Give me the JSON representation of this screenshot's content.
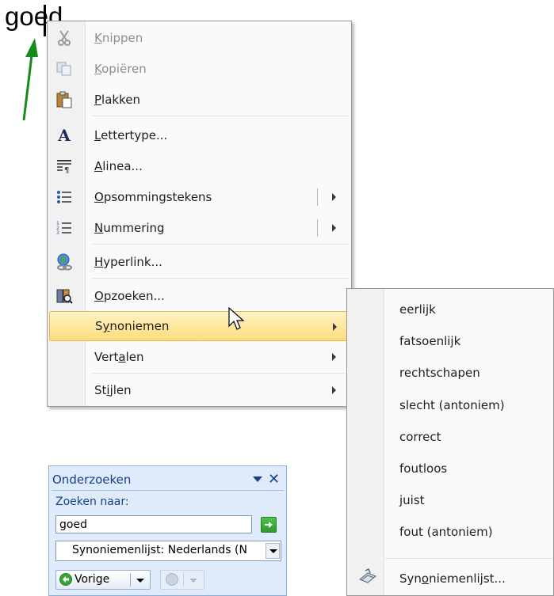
{
  "document": {
    "text": "goed"
  },
  "context_menu": {
    "items": [
      {
        "label": "Knippen",
        "underline": "K",
        "rest": "nippen",
        "icon": "scissors-icon",
        "disabled": true
      },
      {
        "label": "Kopiëren",
        "underline": "K",
        "rest": "opiëren",
        "icon": "copy-icon",
        "disabled": true
      },
      {
        "label": "Plakken",
        "underline": "P",
        "rest": "lakken",
        "icon": "paste-icon",
        "disabled": false
      },
      {
        "label": "Lettertype...",
        "underline": "L",
        "rest": "ettertype...",
        "icon": "font-icon"
      },
      {
        "label": "Alinea...",
        "underline": "A",
        "rest": "linea...",
        "icon": "paragraph-icon"
      },
      {
        "label": "Opsommingstekens",
        "underline": "O",
        "rest": "psommingstekens",
        "icon": "bullets-icon",
        "submenu": true
      },
      {
        "label": "Nummering",
        "underline": "N",
        "rest": "ummering",
        "icon": "numbering-icon",
        "submenu": true
      },
      {
        "label": "Hyperlink...",
        "underline": "H",
        "rest": "yperlink...",
        "icon": "hyperlink-icon"
      },
      {
        "label": "Opzoeken...",
        "underline": "O",
        "rest": "pzoeken...",
        "icon": "research-icon"
      },
      {
        "label": "Synoniemen",
        "pre": "S",
        "underline": "y",
        "rest": "noniemen",
        "submenu": true,
        "highlighted": true
      },
      {
        "label": "Vertalen",
        "pre": "Vert",
        "underline": "a",
        "rest": "len",
        "submenu": true
      },
      {
        "label": "Stijlen",
        "pre": "St",
        "underline": "i",
        "rest": "jlen",
        "submenu": true
      }
    ]
  },
  "synonyms_menu": {
    "items": [
      "eerlijk",
      "fatsoenlijk",
      "rechtschapen",
      "slecht (antoniem)",
      "correct",
      "foutloos",
      "juist",
      "fout (antoniem)"
    ],
    "thesaurus": {
      "pre": "Syn",
      "underline": "o",
      "rest": "niemenlijst...",
      "icon": "thesaurus-icon"
    }
  },
  "research_pane": {
    "title": "Onderzoeken",
    "search_label": "Zoeken naar:",
    "search_value": "goed",
    "source_value": "Synoniemenlijst: Nederlands (N",
    "back_label": "Vorige"
  },
  "colors": {
    "highlight_top": "#fff3c4",
    "highlight_bottom": "#fddc7c",
    "pane_bg": "#dfeafa",
    "pane_title": "#15428b",
    "arrow_green": "#178a1c"
  }
}
